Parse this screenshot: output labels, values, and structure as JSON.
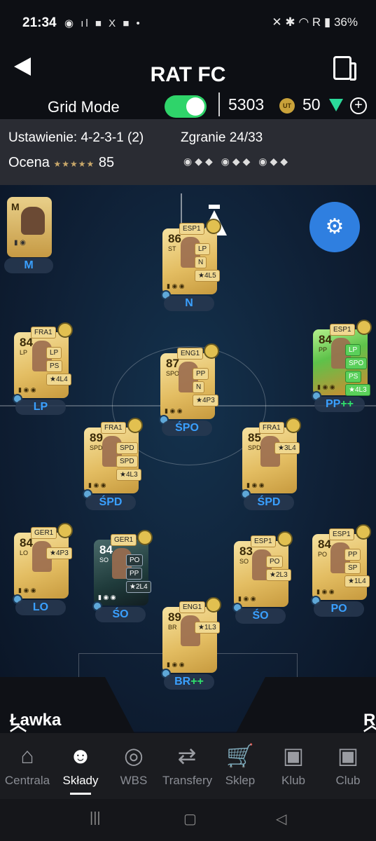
{
  "status": {
    "time": "21:34",
    "battery": "36%"
  },
  "header": {
    "title": "RAT FC",
    "grid_mode_label": "Grid Mode",
    "grid_mode_on": true,
    "coins": "5303",
    "points": "50"
  },
  "info": {
    "formation": "Ustawienie: 4-2-3-1 (2)",
    "chemistry": "Zgranie 24/33",
    "rating_label": "Ocena",
    "rating_stars": "★★★★★",
    "rating_value": "85"
  },
  "manager": {
    "badge": "M",
    "label": "M"
  },
  "players": [
    {
      "slot": "N",
      "ovr": "86",
      "pos": "ST",
      "tags": [
        "ESP1",
        "LP",
        "N",
        "★4L5"
      ]
    },
    {
      "slot": "LP",
      "ovr": "84",
      "pos": "LP",
      "tags": [
        "FRA1",
        "LP",
        "PS",
        "★4L4"
      ]
    },
    {
      "slot": "ŚPO",
      "ovr": "87",
      "pos": "SPO",
      "tags": [
        "ENG1",
        "PP",
        "N",
        "★4P3"
      ]
    },
    {
      "slot": "PP",
      "slot_suffix": "++",
      "ovr": "84",
      "pos": "PP",
      "tags": [
        "ESP1",
        "LP",
        "SPO",
        "PS",
        "★4L3"
      ]
    },
    {
      "slot": "ŚPD",
      "ovr": "89",
      "pos": "SPD",
      "tags": [
        "FRA1",
        "SPD",
        "SPD",
        "★4L3"
      ]
    },
    {
      "slot": "ŚPD",
      "ovr": "85",
      "pos": "SPD",
      "tags": [
        "FRA1",
        "★3L4"
      ]
    },
    {
      "slot": "LO",
      "ovr": "84",
      "pos": "LO",
      "tags": [
        "GER1",
        "★4P3"
      ]
    },
    {
      "slot": "ŚO",
      "ovr": "84",
      "pos": "SO",
      "tags": [
        "GER1",
        "PO",
        "PP",
        "★2L4"
      ]
    },
    {
      "slot": "ŚO",
      "ovr": "83",
      "pos": "SO",
      "tags": [
        "ESP1",
        "PO",
        "★2L3"
      ]
    },
    {
      "slot": "PO",
      "ovr": "84",
      "pos": "PO",
      "tags": [
        "ESP1",
        "PP",
        "SP",
        "★1L4"
      ]
    },
    {
      "slot": "BR",
      "slot_suffix": "++",
      "ovr": "89",
      "pos": "BR",
      "tags": [
        "ENG1",
        "★1L3"
      ]
    }
  ],
  "bench_label": "Ławka",
  "reserve_label": "Rez.",
  "nav": [
    {
      "label": "Centrala",
      "icon": "home-icon"
    },
    {
      "label": "Składy",
      "icon": "team-icon"
    },
    {
      "label": "WBS",
      "icon": "wbs-icon"
    },
    {
      "label": "Transfery",
      "icon": "transfer-icon"
    },
    {
      "label": "Sklep",
      "icon": "cart-icon"
    },
    {
      "label": "Klub",
      "icon": "club-icon"
    },
    {
      "label": "Club",
      "icon": "club-analyzer-icon"
    }
  ]
}
